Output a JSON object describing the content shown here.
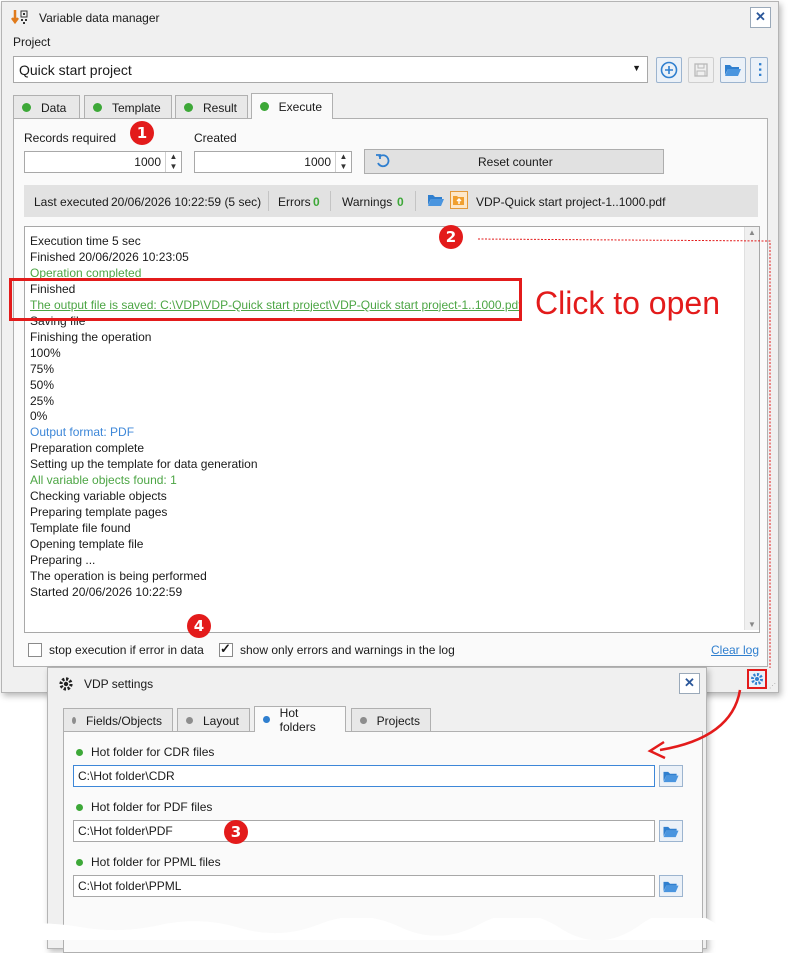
{
  "main_window": {
    "title": "Variable data manager",
    "project_label": "Project",
    "project_value": "Quick start project",
    "tabs": [
      {
        "label": "Data",
        "status": "green"
      },
      {
        "label": "Template",
        "status": "green"
      },
      {
        "label": "Result",
        "status": "green"
      },
      {
        "label": "Execute",
        "status": "green",
        "active": true
      }
    ],
    "records_required_label": "Records required",
    "records_required_value": "1000",
    "created_label": "Created",
    "created_value": "1000",
    "reset_counter_label": "Reset counter",
    "status": {
      "last_executed_label": "Last executed",
      "last_executed_value": "20/06/2026 10:22:59 (5 sec)",
      "errors_label": "Errors",
      "errors_value": "0",
      "warnings_label": "Warnings",
      "warnings_value": "0",
      "output_file": "VDP-Quick start project-1..1000.pdf"
    },
    "log_lines": [
      {
        "text": "Execution time 5 sec",
        "style": "normal"
      },
      {
        "text": "Finished 20/06/2026 10:23:05",
        "style": "normal"
      },
      {
        "text": "Operation completed",
        "style": "green"
      },
      {
        "text": "Finished",
        "style": "normal"
      },
      {
        "text": "The output file is saved: C:\\VDP\\VDP-Quick start project\\VDP-Quick start project-1..1000.pdf",
        "style": "link"
      },
      {
        "text": "Saving file",
        "style": "normal"
      },
      {
        "text": "Finishing the operation",
        "style": "normal"
      },
      {
        "text": "100%",
        "style": "normal"
      },
      {
        "text": "75%",
        "style": "normal"
      },
      {
        "text": "50%",
        "style": "normal"
      },
      {
        "text": "25%",
        "style": "normal"
      },
      {
        "text": "0%",
        "style": "normal"
      },
      {
        "text": "Output format: PDF",
        "style": "blue"
      },
      {
        "text": "Preparation complete",
        "style": "normal"
      },
      {
        "text": "Setting up the template for data generation",
        "style": "normal"
      },
      {
        "text": "All variable objects found: 1",
        "style": "green"
      },
      {
        "text": "Checking variable objects",
        "style": "normal"
      },
      {
        "text": "Preparing template pages",
        "style": "normal"
      },
      {
        "text": "Template file found",
        "style": "normal"
      },
      {
        "text": "Opening template file",
        "style": "normal"
      },
      {
        "text": "Preparing ...",
        "style": "normal"
      },
      {
        "text": "The operation is being performed",
        "style": "normal"
      },
      {
        "text": "Started 20/06/2026 10:22:59",
        "style": "normal"
      }
    ],
    "stop_on_error_label": "stop execution if error in data",
    "stop_on_error_checked": false,
    "show_only_errors_label": "show only errors and warnings in the log",
    "show_only_errors_checked": true,
    "clear_log_label": "Clear log"
  },
  "annotations": {
    "badge_1": "1",
    "badge_2": "2",
    "badge_3": "3",
    "badge_4": "4",
    "click_to_open": "Click to open",
    "accent_color": "#e31b1b"
  },
  "settings_window": {
    "title": "VDP settings",
    "tabs": [
      {
        "label": "Fields/Objects",
        "status": "gray"
      },
      {
        "label": "Layout",
        "status": "gray"
      },
      {
        "label": "Hot folders",
        "status": "blue",
        "active": true
      },
      {
        "label": "Projects",
        "status": "gray"
      }
    ],
    "hot_folders": [
      {
        "label": "Hot folder for CDR files",
        "value": "C:\\Hot folder\\CDR"
      },
      {
        "label": "Hot folder for PDF files",
        "value": "C:\\Hot folder\\PDF"
      },
      {
        "label": "Hot folder for PPML files",
        "value": "C:\\Hot folder\\PPML"
      }
    ]
  }
}
